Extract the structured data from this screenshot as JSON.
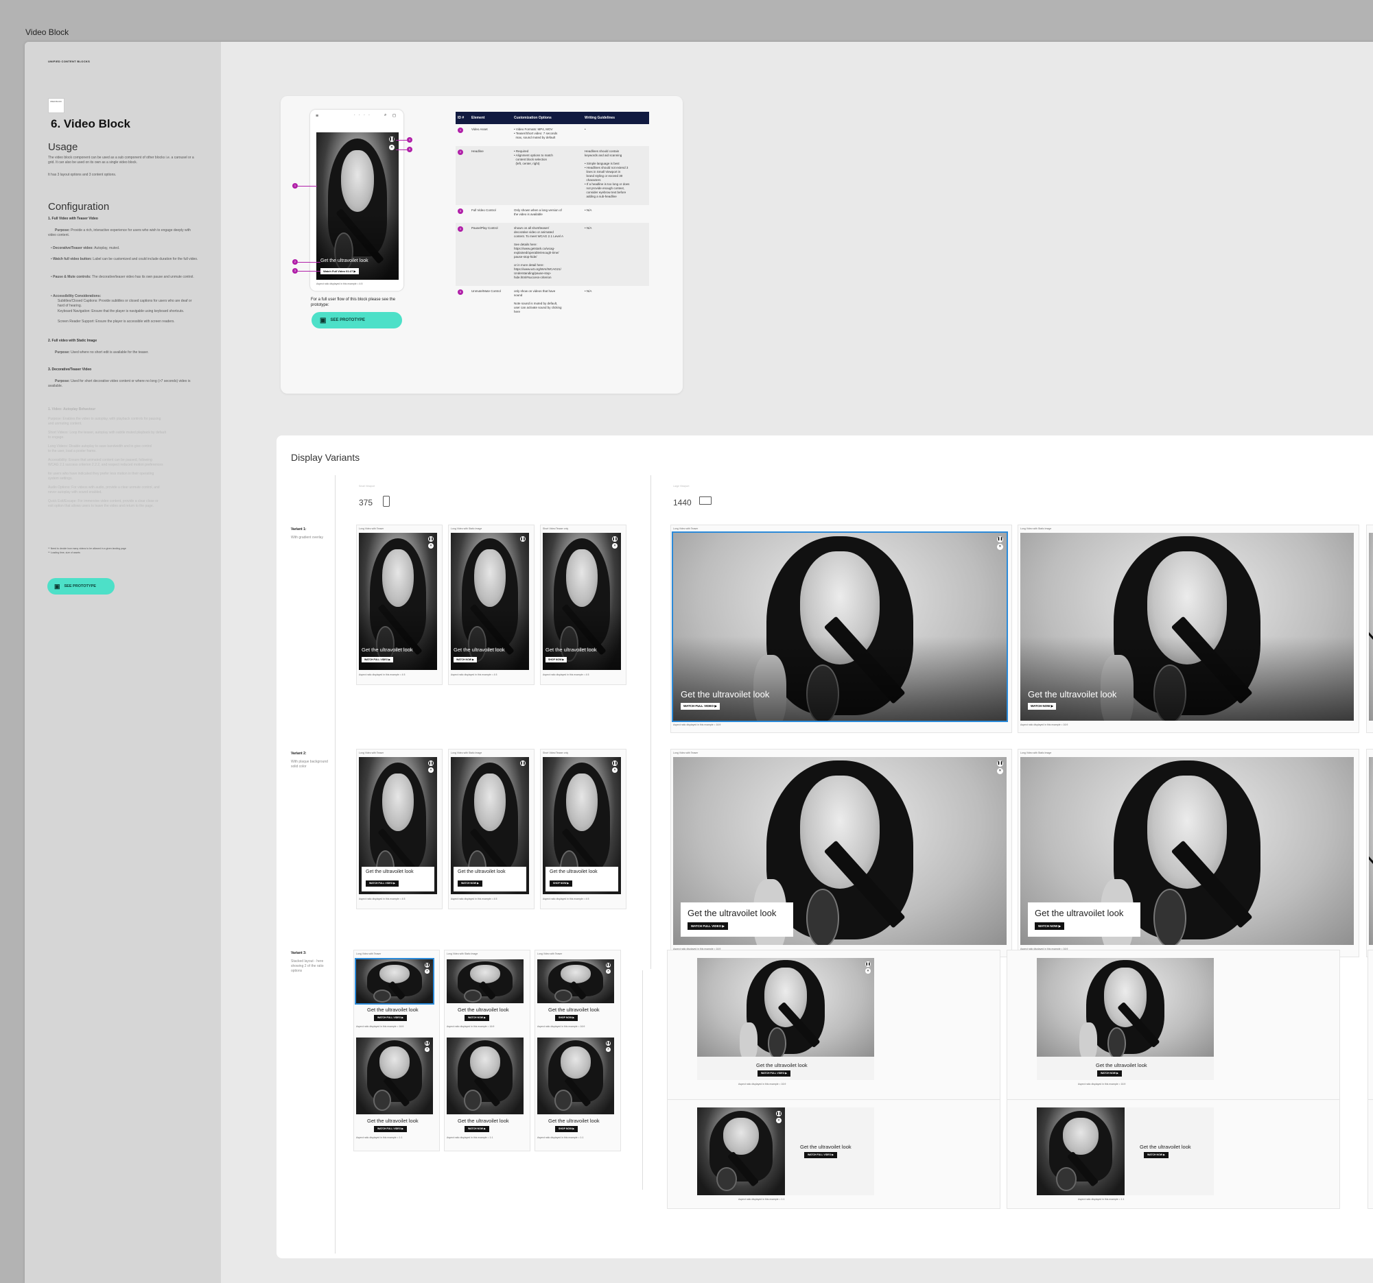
{
  "frame_title": "Video Block",
  "sidebar": {
    "small_title": "UNIFIED CONTENT BLOCKS",
    "thumb_label": "VIDEO BLOCK",
    "title": "6. Video Block",
    "usage_heading": "Usage",
    "usage_p1": "The video block component can be used as a sub component of other blocks i.e. a carousel or a grid. It can also be used on its own as a single video block.",
    "usage_p2": "It has 3 layout options and 3 content options.",
    "config_heading": "Configuration",
    "c1_title": "1. Full Video with Teaser Video",
    "c1_purpose_label": "Purpose:",
    "c1_purpose": "Provide a rich, interactive experience for users who wish to engage deeply with video content.",
    "c1_b1_label": "Decorative/Teaser video:",
    "c1_b1": "Autoplay, muted.",
    "c1_b2_label": "Watch full video button:",
    "c1_b2": "Label can be customized and could include duration for the full video.",
    "c1_b3_label": "Pause & Mute controls:",
    "c1_b3": "The decorative/teaser video has its own pause and unmute control.",
    "c1_b4_label": "Accessibility Considerations:",
    "c1_b4_1": "Subtitles/Closed Captions: Provide subtitles or closed captions for users who are deaf or hard of hearing.",
    "c1_b4_2": "Keyboard Navigation: Ensure that the player is navigable using keyboard shortcuts.",
    "c1_b4_3": "Screen Reader Support: Ensure the player is accessible with screen readers.",
    "c2_title": "2. Full video with Static Image",
    "c2_purpose_label": "Purpose:",
    "c2_purpose": "Used where no short edit is available for the teaser.",
    "c3_title": "3. Decorative/Teaser Video",
    "c3_purpose_label": "Purpose:",
    "c3_purpose": "Used for short decorative video content or where no long (>7 seconds) video is available.",
    "faded_title": "1. Video: Autoplay Behaviour",
    "faded_lines": [
      "Purpose: Enables the video to autoplay, with playback controls for pausing",
      "and unmuting content.",
      "Short Videos: Loop the teaser, autoplay with subtle muted playback by default",
      "to engage.",
      "Long Videos: Disable autoplay to save bandwidth and to give control",
      "to the user, load a poster frame.",
      "Accessibility: Ensure that animated content can be paused, following",
      "WCAG 2.1 success criterion 2.2.2, and respect reduced motion preferences",
      "for users who have indicated they prefer less motion in their operating",
      "system settings.",
      "Audio Options: For videos with audio, provide a clear unmute control, and",
      "never autoplay with sound enabled.",
      "Quick Exit/Escape: For immersive video content, provide a clear close or",
      "exit option that allows users to leave the video and return to the page."
    ],
    "footnote1": "** Need to decide how many videos to be allowed in a given landing page",
    "footnote2": "** Loading time, size of assets",
    "proto_label": "SEE PROTOTYPE"
  },
  "spec_card": {
    "phone_headline": "Get the ultravoilet look",
    "phone_button": "Watch Full Video 01:27",
    "phone_caption": "Aspect ratio displayed in this example = 4:5",
    "flow_text": "For a full user flow of this block please see the prototype:",
    "proto_label": "SEE PROTOTYPE",
    "table_headers": [
      "ID #",
      "Element",
      "Customization Options",
      "Writing Guidelines"
    ],
    "rows": [
      {
        "id": "1",
        "element": "Video Asset",
        "options": [
          "• Video Formats: MP4, MOV",
          "• Teaser/Short video: 7 seconds",
          "  max, sound muted by default"
        ],
        "guidelines": [
          "•"
        ]
      },
      {
        "id": "2",
        "element": "Headline",
        "options": [
          "• Required",
          "• Alignment options to match",
          "  content block selection",
          "  (left, center, right)"
        ],
        "guidelines": [
          "Headlines should contain",
          "keywords and aid scanning",
          "",
          "• Simple language is best",
          "• Headlines should not extend 3",
          "  lines in Small Viewport in",
          "  brand styling or exceed 30",
          "  characters",
          "• If a headline is too long or does",
          "  not provide enough context,",
          "  consider eyebrow text before",
          "  adding a sub-headline"
        ]
      },
      {
        "id": "3",
        "element": "Full Video Control",
        "options": [
          "Only shown when a long version of",
          "the video is available"
        ],
        "guidelines": [
          "• N/A"
        ]
      },
      {
        "id": "4",
        "element": "Pause/Play Control",
        "options": [
          "shown on all short/teaser/",
          "decorative video or animated",
          "content. To meet WCAG 2.1 Level A",
          "",
          "See details here:",
          "https://www.getstark.co/wcag-",
          "explained/operable/enough-time/",
          "pause-stop-hide/",
          "",
          "or in more detail here:",
          "https://www.w3.org/WAI/WCAG21/",
          "Understanding/pause-stop-",
          "hide.html#success-criterion"
        ],
        "guidelines": [
          "• N/A"
        ]
      },
      {
        "id": "5",
        "element": "Unmute/Mute Control",
        "options": [
          "only show on videos that have",
          "sound",
          "",
          "Note sound is muted by default,",
          "user can activate sound by clicking",
          "here"
        ],
        "guidelines": [
          "• N/A"
        ]
      }
    ]
  },
  "variants": {
    "heading": "Display Variants",
    "small_vp_label": "Small Viewport",
    "small_vp_value": "375",
    "large_vp_label": "Large Viewport",
    "large_vp_value": "1440",
    "headline": "Get the ultravoilet look",
    "v1_label": "Variant 1:",
    "v1_desc": "With gradient overlay",
    "v2_label": "Variant 2:",
    "v2_desc": "With plaque background solid color",
    "v3_label": "Variant 3:",
    "v3_desc": "Stacked layout - here showing 2 of the ratio options",
    "mobile_types": [
      "Long Video with Teaser",
      "Long Video with Static Image",
      "Short Video/Teaser only"
    ],
    "v3_mobile_types": [
      "Long Video with Teaser",
      "Long Video with Static Image",
      "Long Video with Teaser"
    ],
    "btn_watch_full": "WATCH FULL VIDEO",
    "btn_watch_now": "WATCH NOW",
    "btn_shop_now": "SHOP NOW",
    "caption_45": "Aspect ratio displayed in this example = 4:5",
    "caption_169": "Aspect ratio displayed in this example = 16:9",
    "caption_11": "Aspect ratio displayed in this example = 1:1"
  }
}
